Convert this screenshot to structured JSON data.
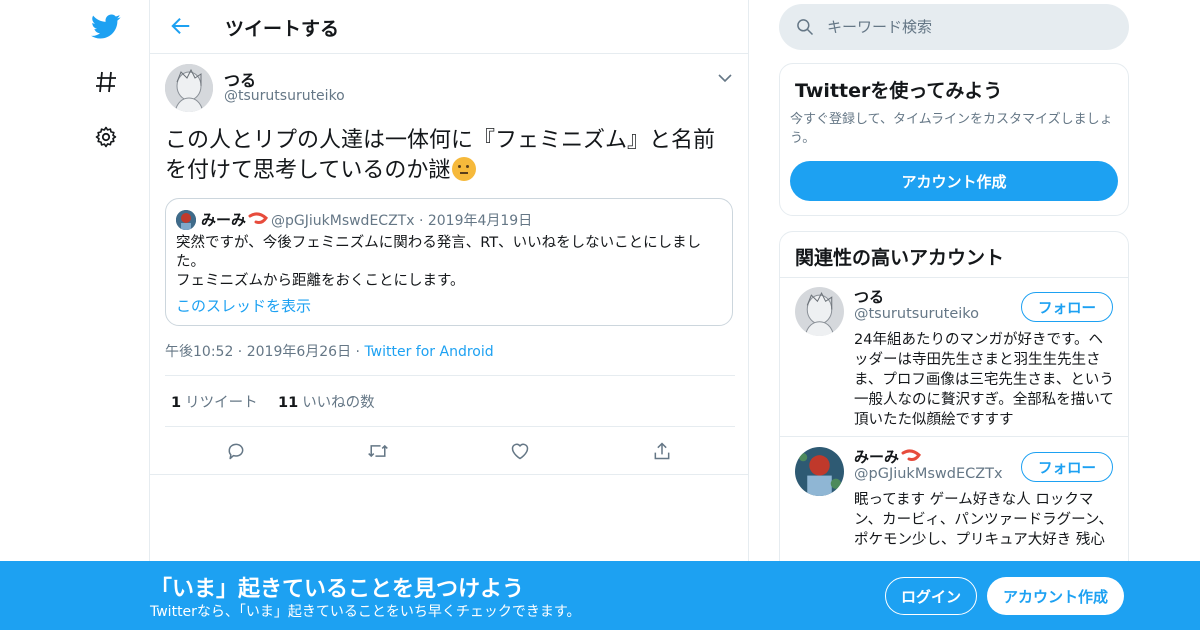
{
  "nav": {
    "icons": [
      "twitter-bird-icon",
      "hashtag-icon",
      "gear-icon"
    ],
    "brand_color": "#1da1f2"
  },
  "header": {
    "title": "ツイートする"
  },
  "tweet": {
    "author_name": "つる",
    "author_handle": "@tsurutsuruteiko",
    "text": "この人とリプの人達は一体何に『フェミニズム』と名前を付けて思考しているのか謎",
    "emoji": "thinking-face-icon",
    "quote": {
      "author_name": "みーみ",
      "author_emoji": "shrimp-icon",
      "author_handle": "@pGJiukMswdECZTx",
      "date": "2019年4月19日",
      "text_line1": "突然ですが、今後フェミニズムに関わる発言、RT、いいねをしないことにしました。",
      "text_line2": "フェミニズムから距離をおくことにします。",
      "thread_link": "このスレッドを表示"
    },
    "time": "午後10:52",
    "date": "2019年6月26日",
    "source": "Twitter for Android",
    "retweet_count": "1",
    "retweet_label": "リツイート",
    "like_count": "11",
    "like_label": "いいねの数",
    "actions": [
      "reply-icon",
      "retweet-icon",
      "like-heart-icon",
      "share-icon"
    ]
  },
  "search": {
    "placeholder": "キーワード検索"
  },
  "signup_card": {
    "title": "Twitterを使ってみよう",
    "description": "今すぐ登録して、タイムラインをカスタマイズしましょう。",
    "button": "アカウント作成"
  },
  "related": {
    "title": "関連性の高いアカウント",
    "follow_label": "フォロー",
    "accounts": [
      {
        "name": "つる",
        "handle": "@tsurutsuruteiko",
        "bio": "24年組あたりのマンガが好きです。ヘッダーは寺田先生さまと羽生生先生さま、プロフ画像は三宅先生さま、という一般人なのに贅沢すぎ。全部私を描いて頂いたた似顔絵ですすす"
      },
      {
        "name": "みーみ",
        "name_emoji": "shrimp-icon",
        "handle": "@pGJiukMswdECZTx",
        "bio": "眠ってます ゲーム好きな人 ロックマン、カービィ、パンツァードラグーン、ポケモン少し、プリキュア大好き 残心"
      }
    ]
  },
  "banner": {
    "title": "「いま」起きていることを見つけよう",
    "subtitle": "Twitterなら、「いま」起きていることをいち早くチェックできます。",
    "login": "ログイン",
    "signup": "アカウント作成"
  }
}
